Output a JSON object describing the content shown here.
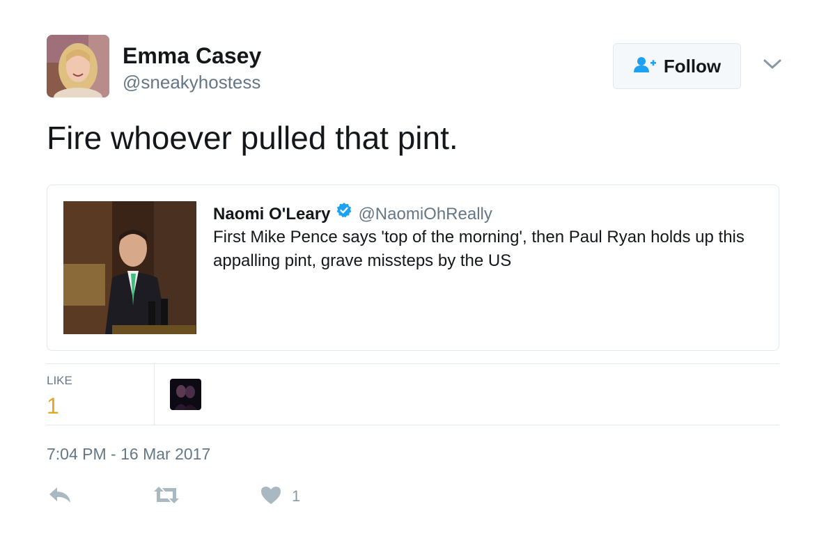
{
  "author": {
    "display_name": "Emma Casey",
    "handle": "@sneakyhostess",
    "avatar_icon": "profile-photo"
  },
  "follow_button": {
    "label": "Follow",
    "icon": "add-user-icon",
    "accent": "#1da1f2"
  },
  "tweet": {
    "text": "Fire whoever pulled that pint."
  },
  "quoted_tweet": {
    "display_name": "Naomi O'Leary",
    "verified": true,
    "handle": "@NaomiOhReally",
    "text": "First Mike Pence says 'top of the morning', then Paul Ryan holds up this appalling pint, grave missteps by the US",
    "media_icon": "speaker-photo"
  },
  "stats": {
    "like_label": "LIKE",
    "like_count": "1",
    "like_count_color": "#e2a828"
  },
  "timestamp": "7:04 PM - 16 Mar 2017",
  "actions": {
    "reply_icon": "reply-icon",
    "retweet_icon": "retweet-icon",
    "like_icon": "heart-icon",
    "like_count": "1"
  },
  "colors": {
    "primary_text": "#14171a",
    "secondary_text": "#657786",
    "border": "#e1e8ed",
    "icon_gray": "#aab8c2",
    "verified_blue": "#1da1f2"
  }
}
